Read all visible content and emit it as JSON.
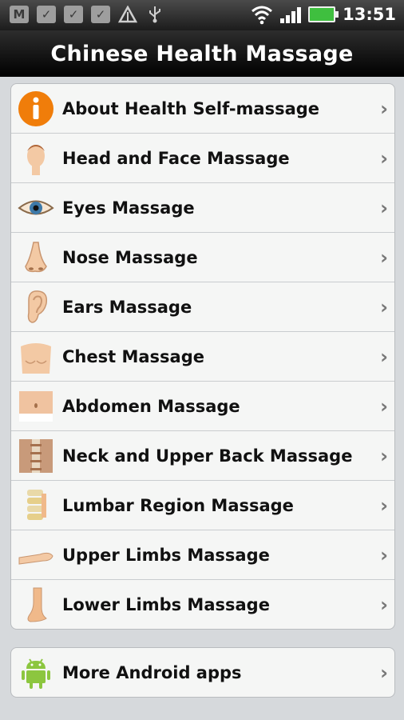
{
  "status_bar": {
    "time": "13:51",
    "icons": [
      "gmail-icon",
      "task-icon",
      "task-icon",
      "task-icon",
      "warning-icon",
      "usb-icon",
      "wifi-icon",
      "signal-icon",
      "battery-icon"
    ]
  },
  "header": {
    "title": "Chinese Health Massage"
  },
  "menu": {
    "items": [
      {
        "label": "About Health Self-massage",
        "icon": "info-icon"
      },
      {
        "label": "Head and Face Massage",
        "icon": "head-icon"
      },
      {
        "label": "Eyes Massage",
        "icon": "eye-icon"
      },
      {
        "label": "Nose Massage",
        "icon": "nose-icon"
      },
      {
        "label": "Ears Massage",
        "icon": "ear-icon"
      },
      {
        "label": "Chest Massage",
        "icon": "chest-icon"
      },
      {
        "label": "Abdomen Massage",
        "icon": "abdomen-icon"
      },
      {
        "label": "Neck and Upper Back Massage",
        "icon": "neck-back-icon"
      },
      {
        "label": "Lumbar Region Massage",
        "icon": "lumbar-icon"
      },
      {
        "label": "Upper Limbs Massage",
        "icon": "upper-limb-icon"
      },
      {
        "label": "Lower Limbs Massage",
        "icon": "lower-limb-icon"
      }
    ]
  },
  "more": {
    "label": "More Android apps",
    "icon": "android-icon"
  },
  "colors": {
    "info_orange": "#f07d0a",
    "android_green": "#8cc63f",
    "skin": "#f3c9a4"
  }
}
